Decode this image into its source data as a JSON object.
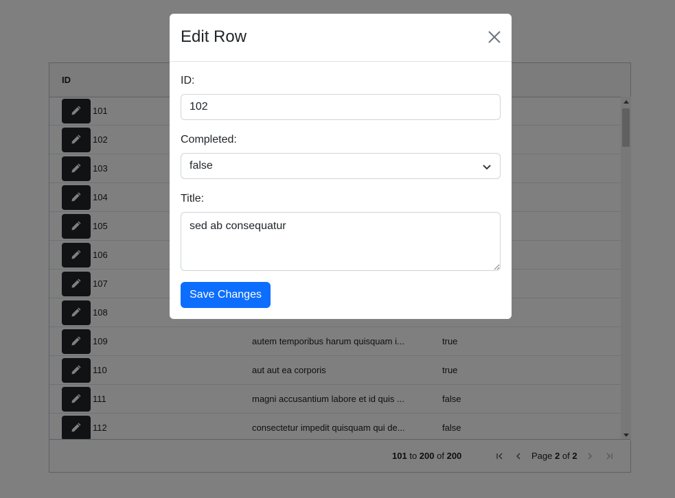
{
  "grid": {
    "columns": {
      "id": "ID"
    },
    "rows": [
      {
        "id": "101",
        "title": "",
        "completed": ""
      },
      {
        "id": "102",
        "title": "",
        "completed": ""
      },
      {
        "id": "103",
        "title": "",
        "completed": ""
      },
      {
        "id": "104",
        "title": "",
        "completed": ""
      },
      {
        "id": "105",
        "title": "",
        "completed": ""
      },
      {
        "id": "106",
        "title": "",
        "completed": ""
      },
      {
        "id": "107",
        "title": "",
        "completed": ""
      },
      {
        "id": "108",
        "title": "",
        "completed": ""
      },
      {
        "id": "109",
        "title": "autem temporibus harum quisquam i...",
        "completed": "true"
      },
      {
        "id": "110",
        "title": "aut aut ea corporis",
        "completed": "true"
      },
      {
        "id": "111",
        "title": "magni accusantium labore et id quis ...",
        "completed": "false"
      },
      {
        "id": "112",
        "title": "consectetur impedit quisquam qui de...",
        "completed": "false"
      }
    ],
    "footer": {
      "row_from": "101",
      "to_word": "to",
      "row_to": "200",
      "of_word": "of",
      "row_total": "200",
      "page_word": "Page",
      "page_current": "2",
      "page_of_word": "of",
      "page_total": "2"
    }
  },
  "modal": {
    "title": "Edit Row",
    "id_label": "ID:",
    "id_value": "102",
    "completed_label": "Completed:",
    "completed_value": "false",
    "title_label": "Title:",
    "title_value": "sed ab consequatur",
    "save_label": "Save Changes"
  },
  "icons": {
    "edit": "pencil-icon",
    "close": "close-icon",
    "first_page": "first-page-icon",
    "prev_page": "prev-page-icon",
    "next_page": "next-page-icon",
    "last_page": "last-page-icon"
  },
  "colors": {
    "primary": "#0d6efd",
    "edit_button": "#212529",
    "backdrop": "rgba(0,0,0,0.5)"
  }
}
